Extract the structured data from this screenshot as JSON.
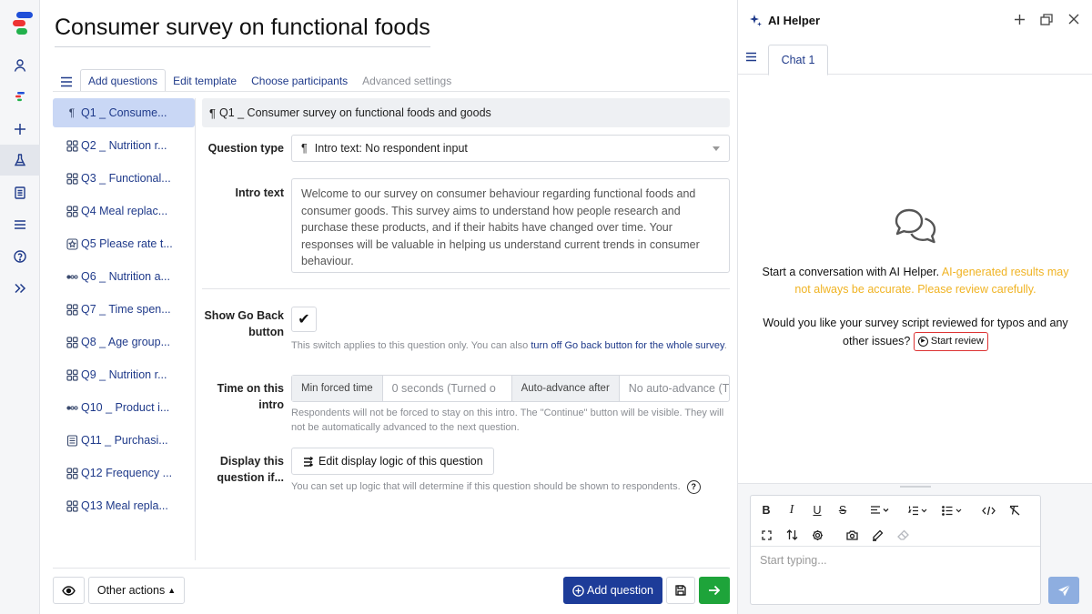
{
  "page": {
    "title": "Consumer survey on functional foods"
  },
  "rail": {
    "items": [
      {
        "icon": "user-icon"
      },
      {
        "icon": "brand-mini-icon"
      },
      {
        "icon": "plus-icon"
      },
      {
        "icon": "flask-icon"
      },
      {
        "icon": "document-icon"
      },
      {
        "icon": "list-icon"
      },
      {
        "icon": "help-icon"
      },
      {
        "icon": "expand-icon"
      }
    ]
  },
  "tabs": [
    {
      "label": "Add questions",
      "state": "active"
    },
    {
      "label": "Edit template",
      "state": "normal"
    },
    {
      "label": "Choose participants",
      "state": "normal"
    },
    {
      "label": "Advanced settings",
      "state": "disabled"
    }
  ],
  "questions": [
    {
      "icon": "pilcrow-icon",
      "label": "Q1  _ Consume..."
    },
    {
      "icon": "grid-icon",
      "label": "Q2  _ Nutrition r..."
    },
    {
      "icon": "grid-icon",
      "label": "Q3  _ Functional..."
    },
    {
      "icon": "grid-icon",
      "label": "Q4  Meal replac..."
    },
    {
      "icon": "star-icon",
      "label": "Q5  Please rate t..."
    },
    {
      "icon": "dots-icon",
      "label": "Q6  _ Nutrition a..."
    },
    {
      "icon": "grid-icon",
      "label": "Q7  _ Time spen..."
    },
    {
      "icon": "grid-icon",
      "label": "Q8  _ Age group..."
    },
    {
      "icon": "grid-icon",
      "label": "Q9  _ Nutrition r..."
    },
    {
      "icon": "dots-icon",
      "label": "Q10  _ Product i..."
    },
    {
      "icon": "doc-icon",
      "label": "Q11  _ Purchasi..."
    },
    {
      "icon": "grid-icon",
      "label": "Q12  Frequency ..."
    },
    {
      "icon": "grid-icon",
      "label": "Q13  Meal repla..."
    }
  ],
  "editor": {
    "header": "Q1   _ Consumer survey on functional foods and goods",
    "question_type_label": "Question type",
    "question_type_value": "Intro text: No respondent input",
    "intro_label": "Intro text",
    "intro_text": "Welcome to our survey on consumer behaviour regarding functional foods and consumer goods. This survey aims to understand how people research and purchase these products, and if their habits have changed over time. Your responses will be valuable in helping us understand current trends in consumer behaviour.",
    "goback_label_1": "Show Go Back",
    "goback_label_2": "button",
    "goback_check": "✔",
    "goback_help": "This switch applies to this question only. You can also ",
    "goback_link": "turn off Go back button for the whole survey",
    "goback_help_end": ".",
    "time_label_1": "Time on this",
    "time_label_2": "intro",
    "min_time_label": "Min forced time",
    "min_time_placeholder": "0 seconds (Turned o",
    "auto_adv_label": "Auto-advance after",
    "auto_adv_placeholder": "No auto-advance (T",
    "time_help": "Respondents will not be forced to stay on this intro. The \"Continue\" button will be visible. They will not be automatically advanced to the next question.",
    "display_label_1": "Display this",
    "display_label_2": "question if...",
    "logic_button": "Edit display logic of this question",
    "logic_help": "You can set up logic that will determine if this question should be shown to respondents.",
    "logic_help_icon": "?"
  },
  "bottom": {
    "other_actions": "Other actions",
    "add_question": "Add question"
  },
  "panel": {
    "title": "AI Helper",
    "chat_tab": "Chat 1",
    "intro_1": "Start a conversation with AI Helper. ",
    "intro_warn": "AI-generated results may not always be accurate. Please review carefully.",
    "review_prompt": "Would you like your survey script reviewed for typos and any other issues?",
    "review_button": "Start review",
    "placeholder": "Start typing..."
  },
  "colors": {
    "primary": "#1d3c99",
    "link": "#1f3a8a",
    "success": "#1ea43a",
    "warning": "#f0b323",
    "selected": "#c9d7f5"
  }
}
